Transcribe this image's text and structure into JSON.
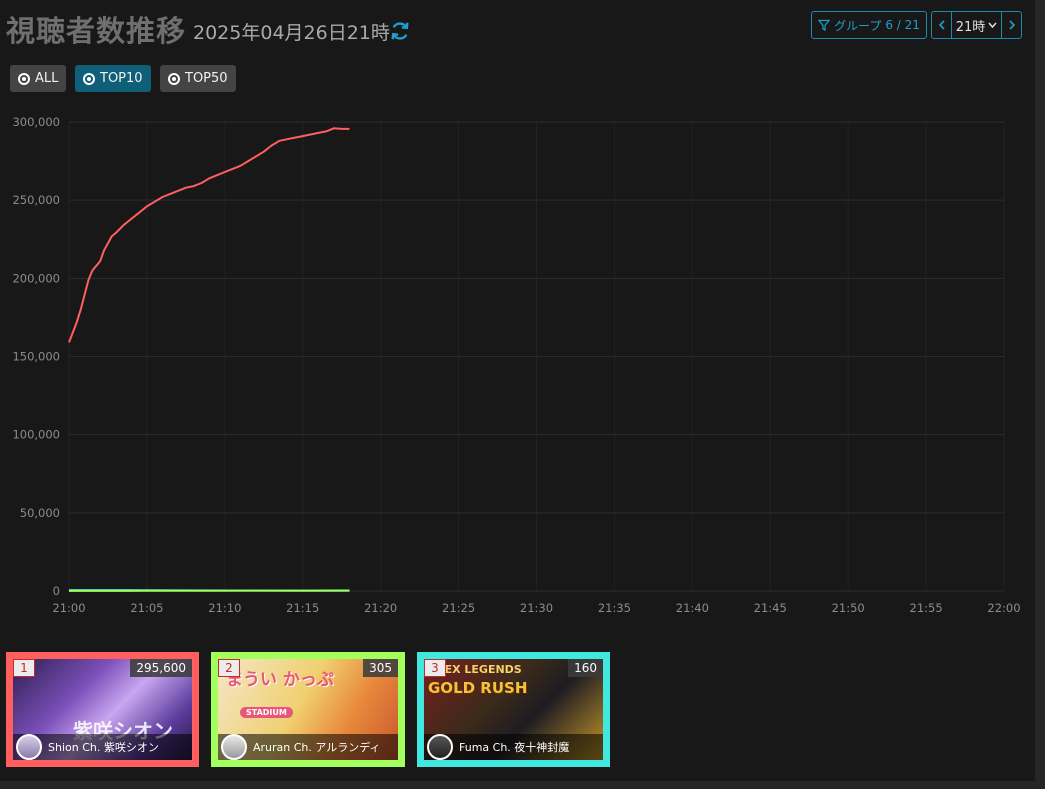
{
  "header": {
    "title": "視聴者数推移",
    "subtitle": "2025年04月26日21時",
    "group_label": "グループ",
    "group_count": "6 / 21",
    "hour_label": "21時"
  },
  "filters": [
    {
      "label": "ALL",
      "active": false
    },
    {
      "label": "TOP10",
      "active": true
    },
    {
      "label": "TOP50",
      "active": false
    }
  ],
  "colors": {
    "series1": "#ff5f5f",
    "series2": "#a3ff5c",
    "series3": "#40e8e0",
    "accent": "#1e9fd0"
  },
  "chart_data": {
    "type": "line",
    "xlim": [
      "21:00",
      "22:00"
    ],
    "ylim": [
      0,
      300000
    ],
    "x_ticks": [
      "21:00",
      "21:05",
      "21:10",
      "21:15",
      "21:20",
      "21:25",
      "21:30",
      "21:35",
      "21:40",
      "21:45",
      "21:50",
      "21:55",
      "22:00"
    ],
    "y_ticks": [
      "0",
      "50,000",
      "100,000",
      "150,000",
      "200,000",
      "250,000",
      "300,000"
    ],
    "grid": true,
    "series": [
      {
        "color": "#ff5f5f",
        "x": [
          "21:00",
          "21:00:30",
          "21:00:45",
          "21:01:15",
          "21:01:30",
          "21:02",
          "21:02:15",
          "21:02:45",
          "21:03",
          "21:03:30",
          "21:04",
          "21:04:30",
          "21:05",
          "21:05:30",
          "21:06",
          "21:06:30",
          "21:07",
          "21:07:30",
          "21:08",
          "21:08:30",
          "21:09",
          "21:09:30",
          "21:10",
          "21:10:30",
          "21:11",
          "21:11:30",
          "21:12",
          "21:12:30",
          "21:13",
          "21:13:30",
          "21:14",
          "21:14:30",
          "21:15",
          "21:15:30",
          "21:16",
          "21:16:30",
          "21:17",
          "21:17:30",
          "21:18"
        ],
        "values": [
          159000,
          172000,
          180000,
          199000,
          205000,
          211000,
          218000,
          227000,
          229000,
          234000,
          238000,
          242000,
          246000,
          249000,
          252000,
          254000,
          256000,
          258000,
          259000,
          261000,
          264000,
          266000,
          268000,
          270000,
          272000,
          275000,
          278000,
          281000,
          285000,
          288000,
          289000,
          290000,
          291000,
          292000,
          293000,
          294000,
          296000,
          295600,
          295600
        ]
      },
      {
        "color": "#a3ff5c",
        "x": [
          "21:00",
          "21:05",
          "21:10",
          "21:15",
          "21:18"
        ],
        "values": [
          40,
          120,
          210,
          280,
          305
        ]
      },
      {
        "color": "#40e8e0",
        "x": [
          "21:00",
          "21:05",
          "21:10",
          "21:15",
          "21:18"
        ],
        "values": [
          600,
          480,
          320,
          200,
          160
        ]
      }
    ]
  },
  "ranking": [
    {
      "rank": "1",
      "viewers": "295,600",
      "channel": "Shion Ch. 紫咲シオン",
      "thumb_text": "紫咲シオン",
      "border": "#ff5f5f"
    },
    {
      "rank": "2",
      "viewers": "305",
      "channel": "Aruran Ch. アルランディ",
      "thumb_text": "まうい かっぷ",
      "thumb_text2": "STADIUM",
      "border": "#a3ff5c"
    },
    {
      "rank": "3",
      "viewers": "160",
      "channel": "Fuma Ch. 夜十神封魔",
      "thumb_text": "APEX LEGENDS",
      "thumb_text2": "GOLD RUSH",
      "border": "#40e8e0"
    }
  ]
}
